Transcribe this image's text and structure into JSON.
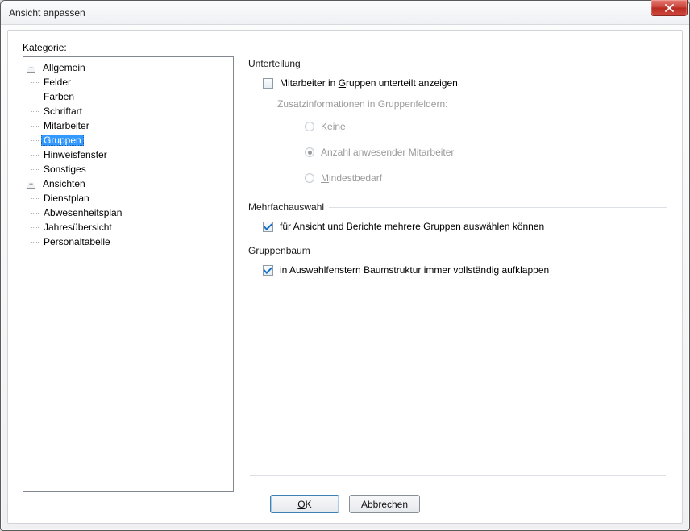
{
  "title": "Ansicht anpassen",
  "category_label_pre": "K",
  "category_label_rest": "ategorie:",
  "tree": {
    "node0": {
      "label": "Allgemein"
    },
    "node0_children": {
      "c0": "Felder",
      "c1": "Farben",
      "c2": "Schriftart",
      "c3": "Mitarbeiter",
      "c4": "Gruppen",
      "c5": "Hinweisfenster",
      "c6": "Sonstiges"
    },
    "node1": {
      "label": "Ansichten"
    },
    "node1_children": {
      "c0": "Dienstplan",
      "c1": "Abwesenheitsplan",
      "c2": "Jahresübersicht",
      "c3": "Personaltabelle"
    }
  },
  "group_unterteilung": {
    "title": "Unterteilung",
    "checkbox_label_pre": "Mitarbeiter in ",
    "checkbox_label_ul": "G",
    "checkbox_label_post": "ruppen unterteilt anzeigen",
    "checkbox_checked": false,
    "sublabel": "Zusatzinformationen in Gruppenfeldern:",
    "radio0_ul": "K",
    "radio0_post": "eine",
    "radio1": "Anzahl anwesender Mitarbeiter",
    "radio2_ul": "M",
    "radio2_post": "indestbedarf",
    "radio_selected": 1
  },
  "group_mehrfach": {
    "title": "Mehrfachauswahl",
    "label": "für Ansicht und Berichte mehrere Gruppen auswählen können",
    "checked": true
  },
  "group_baum": {
    "title": "Gruppenbaum",
    "label": "in Auswahlfenstern Baumstruktur immer vollständig aufklappen",
    "checked": true
  },
  "buttons": {
    "ok_ul": "O",
    "ok_post": "K",
    "cancel": "Abbrechen"
  }
}
